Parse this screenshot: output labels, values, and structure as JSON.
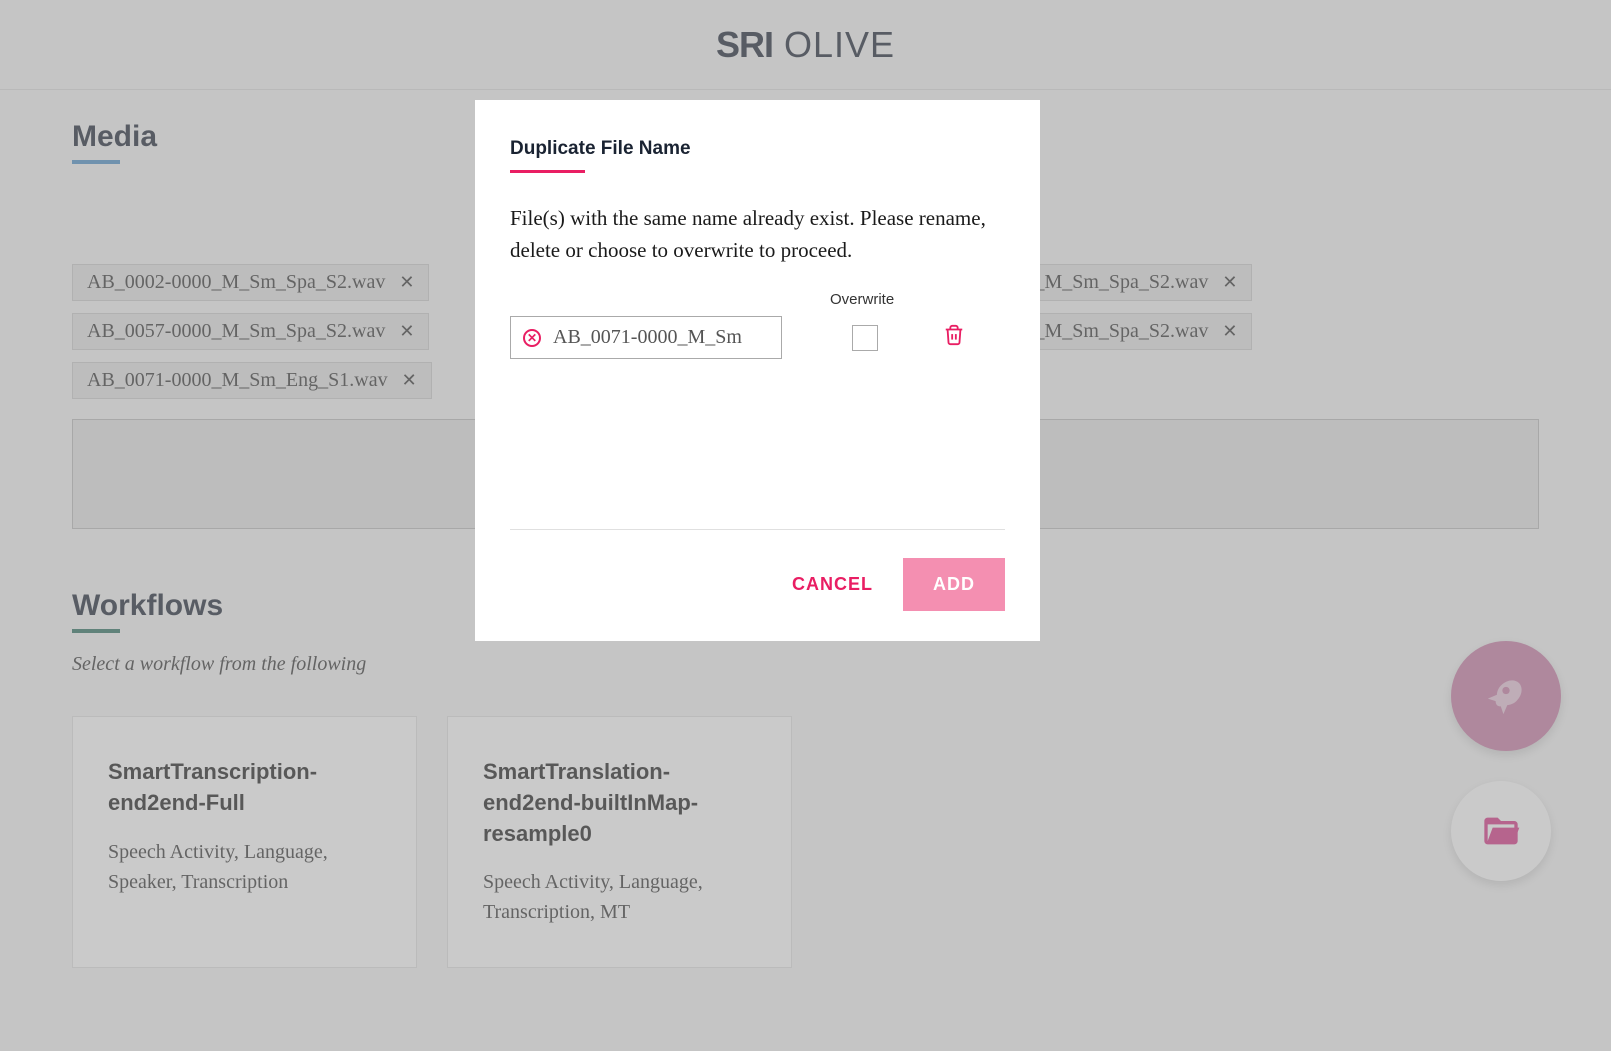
{
  "header": {
    "logo_bold": "SRI",
    "logo_light": "OLIVE"
  },
  "media": {
    "title": "Media",
    "chips": [
      "AB_0002-0000_M_Sm_Spa_S2.wav",
      "_M_Sm_Spa_S2.wav",
      "AB_0057-0000_M_Sm_Spa_S2.wav",
      "_M_Sm_Spa_S2.wav",
      "AB_0071-0000_M_Sm_Eng_S1.wav"
    ]
  },
  "workflows": {
    "title": "Workflows",
    "subtitle": "Select a workflow from the following",
    "cards": [
      {
        "title": "SmartTranscription-end2end-Full",
        "desc": "Speech Activity, Language, Speaker, Transcription"
      },
      {
        "title": "SmartTranslation-end2end-builtInMap-resample0",
        "desc": "Speech Activity, Language, Transcription, MT"
      }
    ]
  },
  "modal": {
    "title": "Duplicate File Name",
    "message": "File(s) with the same name already exist. Please rename, delete or choose to overwrite to proceed.",
    "overwrite_label": "Overwrite",
    "file_input_value": "AB_0071-0000_M_Sm",
    "cancel_label": "CANCEL",
    "add_label": "ADD"
  }
}
